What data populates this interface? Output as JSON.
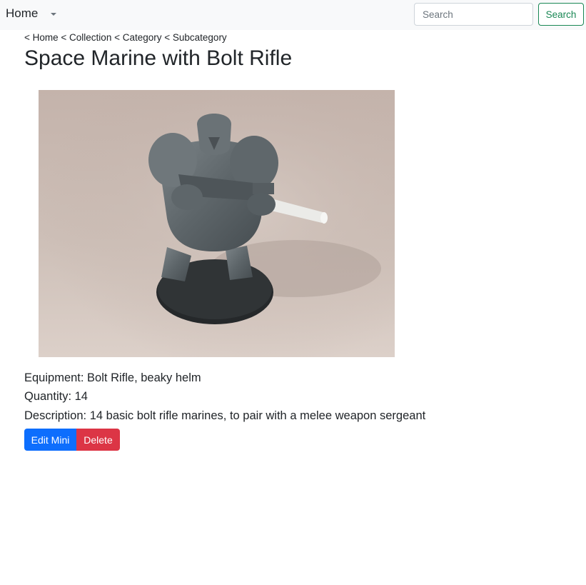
{
  "navbar": {
    "brand": "Home",
    "search": {
      "placeholder": "Search",
      "value": "",
      "button_label": "Search"
    }
  },
  "breadcrumb": {
    "items": [
      "< Home",
      " < Collection",
      " < Category",
      " < Subcategory"
    ]
  },
  "page": {
    "title": "Space Marine with Bolt Rifle"
  },
  "details": {
    "equipment": "Equipment: Bolt Rifle, beaky helm",
    "quantity": "Quantity: 14",
    "description": "Description: 14 basic bolt rifle marines, to pair with a melee weapon sergeant"
  },
  "actions": {
    "edit_label": "Edit Mini",
    "delete_label": "Delete"
  },
  "colors": {
    "primary": "#0d6efd",
    "danger": "#dc3545",
    "success": "#198754",
    "navbar_bg": "#f8f9fa"
  },
  "icons": {
    "dropdown": "caret-down-icon"
  }
}
